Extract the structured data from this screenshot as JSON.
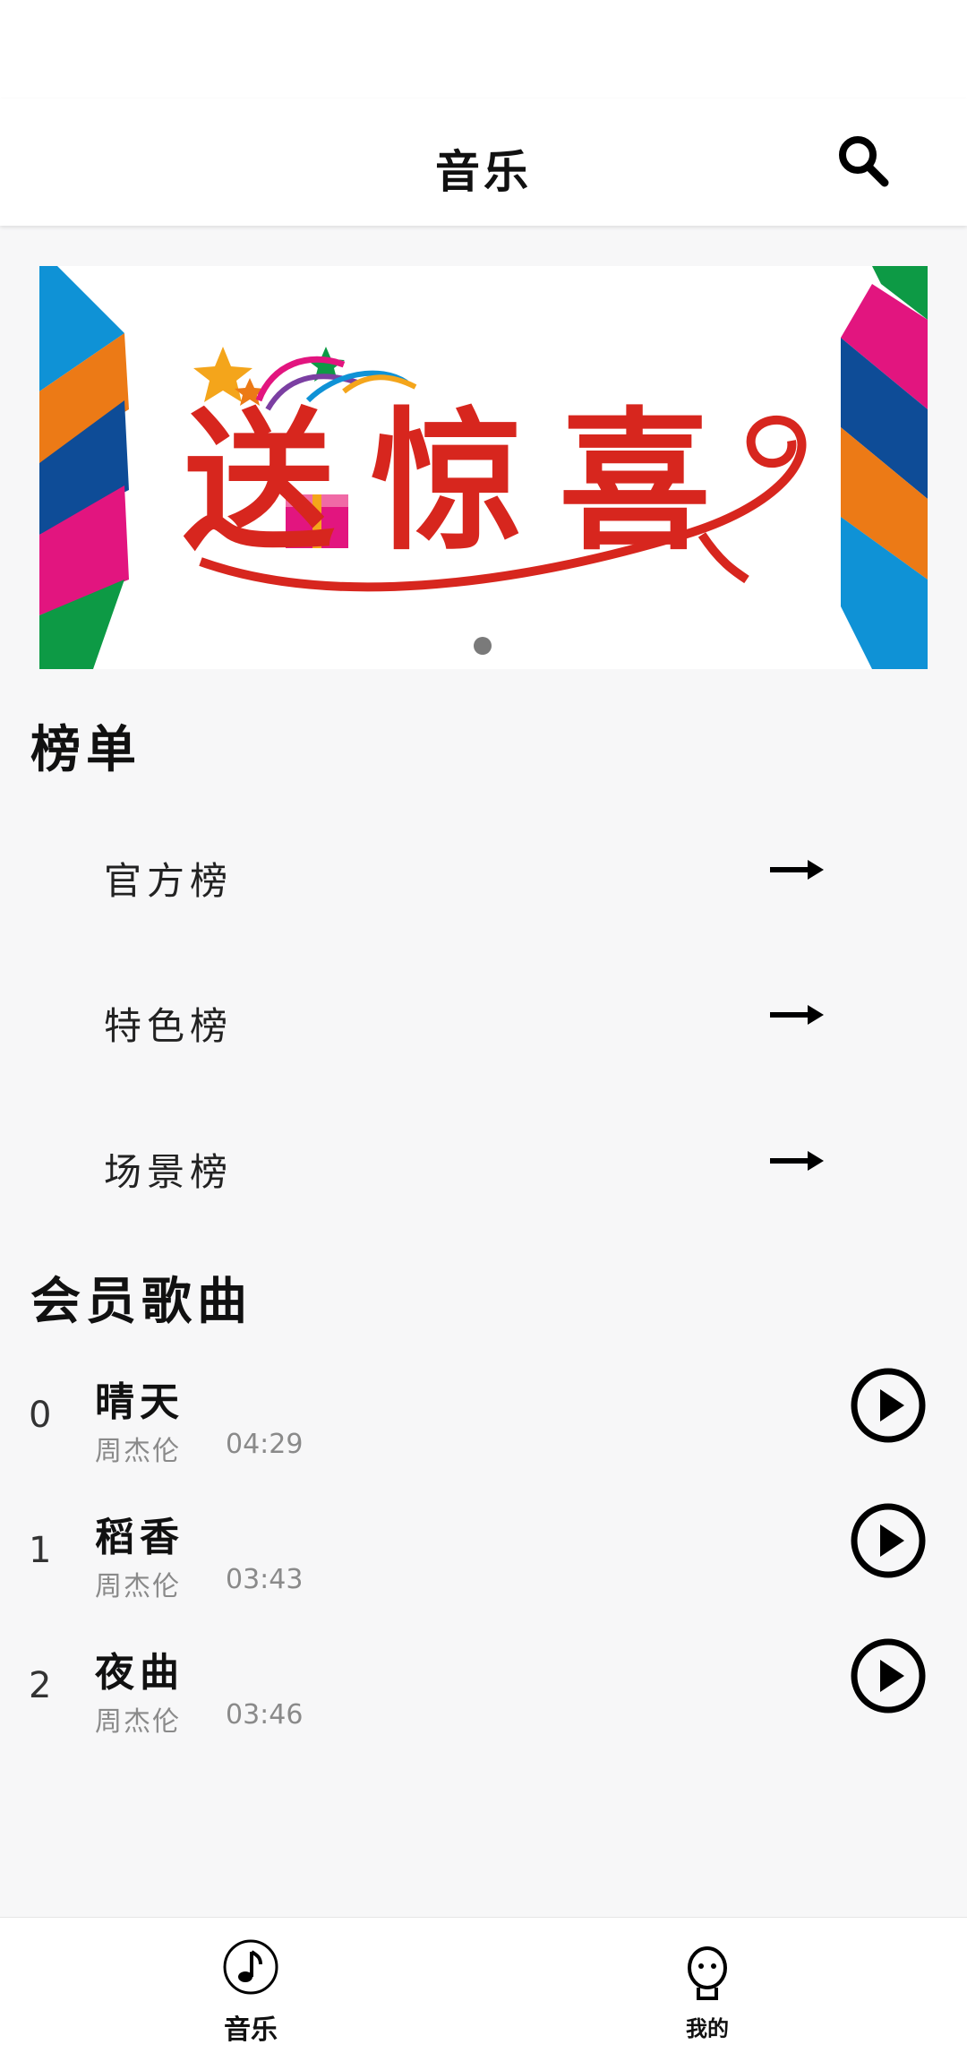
{
  "app_bar": {
    "title": "音乐",
    "search_icon": "search-icon"
  },
  "banner": {
    "text": "送惊喜",
    "dots": 1
  },
  "rankings": {
    "title": "榜单",
    "items": [
      {
        "label": "官方榜",
        "icon": "arrow-right-icon"
      },
      {
        "label": "特色榜",
        "icon": "arrow-right-icon"
      },
      {
        "label": "场景榜",
        "icon": "arrow-right-icon"
      }
    ]
  },
  "vip_songs": {
    "title": "会员歌曲",
    "songs": [
      {
        "index": "0",
        "title": "晴天",
        "artist": "周杰伦",
        "duration": "04:29"
      },
      {
        "index": "1",
        "title": "稻香",
        "artist": "周杰伦",
        "duration": "03:43"
      },
      {
        "index": "2",
        "title": "夜曲",
        "artist": "周杰伦",
        "duration": "03:46"
      }
    ]
  },
  "bottom_nav": {
    "items": [
      {
        "label": "音乐",
        "icon": "music-note-icon"
      },
      {
        "label": "我的",
        "icon": "profile-icon"
      }
    ]
  },
  "colors": {
    "banner_red": "#d7261e",
    "banner_blue": "#0f92d6",
    "banner_pink": "#e2157f",
    "banner_orange": "#ec7a16",
    "banner_navy": "#0e4c97",
    "banner_green": "#0d9a45"
  }
}
